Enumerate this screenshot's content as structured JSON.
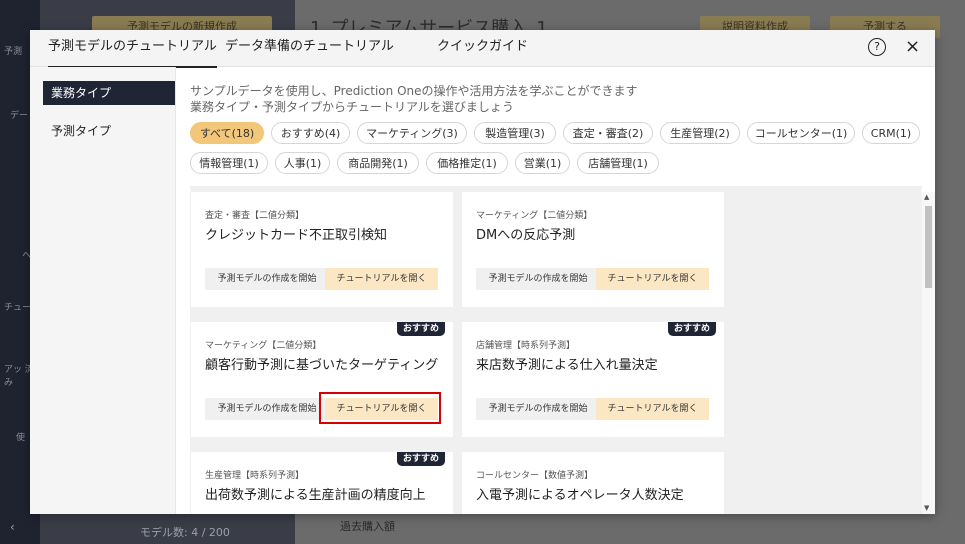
{
  "background": {
    "new_model_button": "予測モデルの新規作成",
    "page_title": "1_プレミアムサービス購入_1",
    "explain_button": "説明資料作成",
    "predict_button": "予測する",
    "sidebar_labels": [
      "予測",
      "デー",
      "ヘ",
      "チュー",
      "アッ 済み",
      "使"
    ],
    "model_count": "モデル数: 4 / 200",
    "bottom_text": "過去購入額"
  },
  "modal": {
    "tabs": [
      {
        "label": "予測モデルのチュートリアル",
        "active": true
      },
      {
        "label": "データ準備のチュートリアル",
        "active": false
      },
      {
        "label": "クイックガイド",
        "active": false
      }
    ],
    "help_icon": "?",
    "close_icon": "×",
    "side_nav": [
      {
        "label": "業務タイプ",
        "active": true
      },
      {
        "label": "予測タイプ",
        "active": false
      }
    ],
    "description_line1": "サンプルデータを使用し、Prediction Oneの操作や活用方法を学ぶことができます",
    "description_line2": "業務タイプ・予測タイプからチュートリアルを選びましょう",
    "filters_row1": [
      "すべて(18)",
      "おすすめ(4)",
      "マーケティング(3)",
      "製造管理(3)",
      "査定・審査(2)",
      "生産管理(2)",
      "コールセンター(1)",
      "CRM(1)"
    ],
    "filters_row2": [
      "情報管理(1)",
      "人事(1)",
      "商品開発(1)",
      "価格推定(1)",
      "営業(1)",
      "店舗管理(1)"
    ],
    "cards": [
      {
        "category": "査定・審査【二値分類】",
        "title": "クレジットカード不正取引検知",
        "recommended": false
      },
      {
        "category": "マーケティング【二値分類】",
        "title": "DMへの反応予測",
        "recommended": false
      },
      {
        "category": "マーケティング【二値分類】",
        "title": "顧客行動予測に基づいたターゲティング",
        "recommended": true
      },
      {
        "category": "店舗管理【時系列予測】",
        "title": "来店数予測による仕入れ量決定",
        "recommended": true
      },
      {
        "category": "生産管理【時系列予測】",
        "title": "出荷数予測による生産計画の精度向上",
        "recommended": true
      },
      {
        "category": "コールセンター【数値予測】",
        "title": "入電予測によるオペレータ人数決定",
        "recommended": false
      }
    ],
    "create_label": "予測モデルの作成を開始",
    "open_label": "チュートリアルを開く",
    "badge_label": "おすすめ",
    "accent_color": "#f2c77a",
    "highlight_color": "#d60000"
  }
}
